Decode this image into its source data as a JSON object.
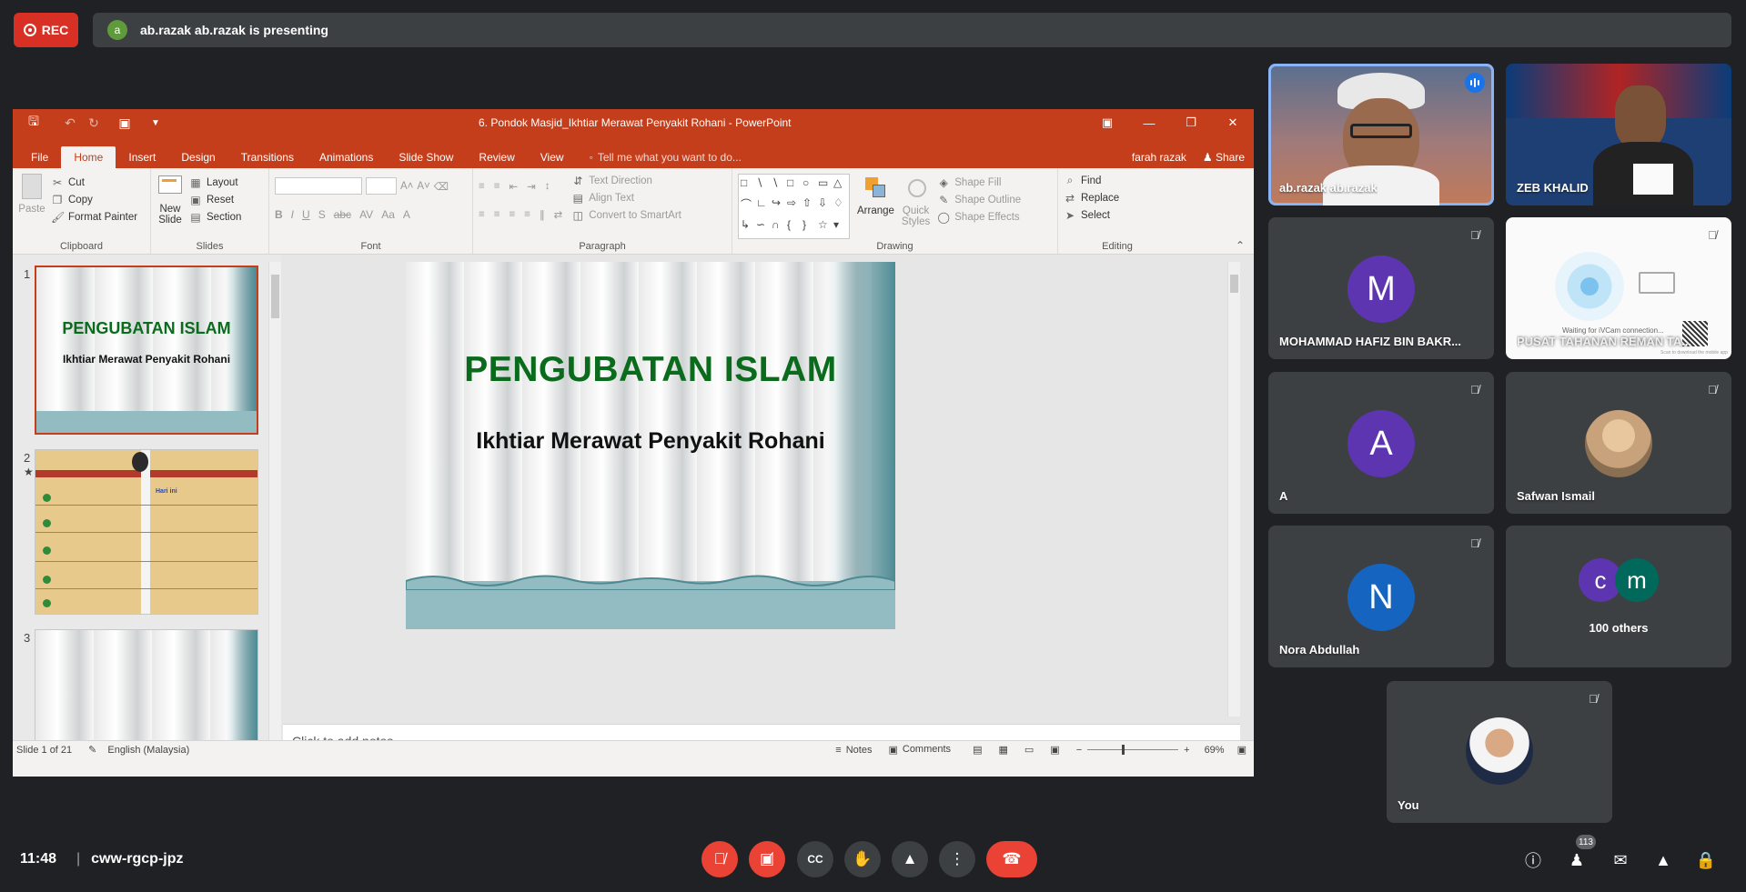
{
  "meet": {
    "rec_label": "REC",
    "presenter_initial": "a",
    "presenting_text": "ab.razak ab.razak is presenting",
    "clock": "11:48",
    "code": "cww-rgcp-jpz",
    "participant_count": "113",
    "others_label": "100 others"
  },
  "participants": [
    {
      "name": "ab.razak ab.razak"
    },
    {
      "name": "ZEB KHALID"
    },
    {
      "name": "MOHAMMAD HAFIZ BIN BAKR...",
      "initial": "M",
      "color": "#5e35b1"
    },
    {
      "name": "PUSAT TAHANAN REMAN TA...",
      "screen_text": "Waiting for iVCam connection...",
      "screen_subtext": "Scan to download the mobile app"
    },
    {
      "name": "A",
      "initial": "A",
      "color": "#5e35b1"
    },
    {
      "name": "Safwan Ismail"
    },
    {
      "name": "Nora Abdullah",
      "initial": "N",
      "color": "#1565c0"
    },
    {
      "others_initials": [
        "c",
        "m"
      ],
      "colors": [
        "#5e35b1",
        "#00695c"
      ]
    },
    {
      "name": "You"
    }
  ],
  "ppt": {
    "title": "6. Pondok Masjid_Ikhtiar Merawat Penyakit Rohani - PowerPoint",
    "tabs": [
      "File",
      "Home",
      "Insert",
      "Design",
      "Transitions",
      "Animations",
      "Slide Show",
      "Review",
      "View"
    ],
    "tell_me": "Tell me what you want to do...",
    "user": "farah razak",
    "share": "Share",
    "ribbon": {
      "paste": "Paste",
      "cut": "Cut",
      "copy": "Copy",
      "format_painter": "Format Painter",
      "clipboard": "Clipboard",
      "new_slide_1": "New",
      "new_slide_2": "Slide",
      "layout": "Layout",
      "reset": "Reset",
      "section": "Section",
      "slides": "Slides",
      "font": "Font",
      "text_direction": "Text Direction",
      "align_text": "Align Text",
      "convert_smartart": "Convert to SmartArt",
      "paragraph": "Paragraph",
      "arrange": "Arrange",
      "quick_styles_1": "Quick",
      "quick_styles_2": "Styles",
      "shape_fill": "Shape Fill",
      "shape_outline": "Shape Outline",
      "shape_effects": "Shape Effects",
      "drawing": "Drawing",
      "find": "Find",
      "replace": "Replace",
      "select": "Select",
      "editing": "Editing"
    },
    "slide_title": "PENGUBATAN ISLAM",
    "slide_subtitle": "Ikhtiar Merawat Penyakit Rohani",
    "thumb_numbers": [
      "1",
      "2",
      "3"
    ],
    "thumb2_note": "Hari ini",
    "notes_placeholder": "Click to add notes",
    "status": {
      "slide": "Slide 1 of 21",
      "language": "English (Malaysia)",
      "notes": "Notes",
      "comments": "Comments",
      "zoom": "69%"
    }
  },
  "colors": {
    "ppt_accent": "#c43e1c",
    "slide_title": "#0b6b1d",
    "meet_bg": "#202124",
    "tile_bg": "#3c4043",
    "end_call": "#ea4335"
  }
}
